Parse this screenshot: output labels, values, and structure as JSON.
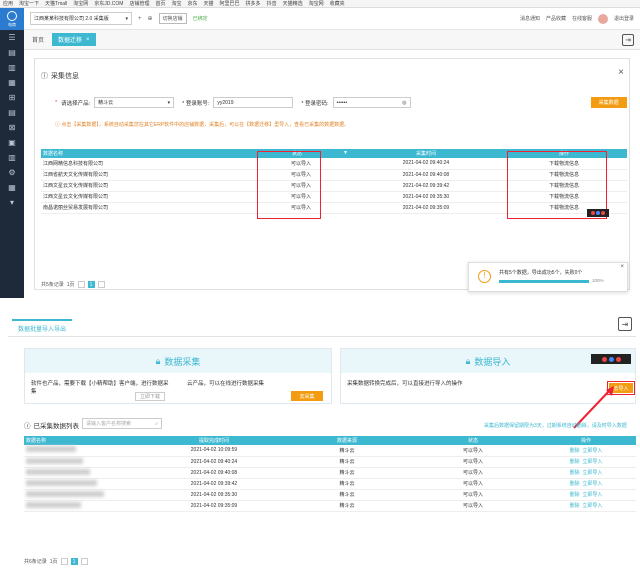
{
  "bookmarks": [
    "应用",
    "淘宝一下",
    "天猫Tmall",
    "淘宝网",
    "京东JD.COM",
    "店铺管理",
    "首页",
    "淘宝",
    "京东",
    "天猫",
    "阿里巴巴",
    "拼多多",
    "抖音",
    "天猫精选",
    "淘宝网",
    "收藏夹"
  ],
  "sidebar": {
    "logo_text": "电商",
    "icons": [
      "☰",
      "▤",
      "▥",
      "▦",
      "⊞",
      "▤",
      "⊠",
      "▣",
      "▥",
      "⚙",
      "▦",
      "▾"
    ]
  },
  "topbar": {
    "store_name": "江西某某科技有限公司 2.0 采集版",
    "refresh_btn": "切换店铺",
    "status": "已绑定",
    "right_items": [
      "消息通知",
      "产品收藏",
      "在线客服",
      "退出登录"
    ]
  },
  "tabs": {
    "home": "首页",
    "active": "数据迁移",
    "close": "×"
  },
  "modal1": {
    "title": "采集信息",
    "close": "×",
    "form": {
      "product_label": "请选择产品:",
      "product_value": "精斗云",
      "account_label": "* 登录账号:",
      "account_value": "yy2019",
      "password_label": "* 登录密码:",
      "password_value": "••••••",
      "submit": "采集数据"
    },
    "notice": "ⓘ 点击【采集数据】，系统自动采集您在其它ERP软件中的店铺数据，采集后，可以在【数据迁移】里导入，查看已采集的数据数据。",
    "table": {
      "headers": [
        "数据名称",
        "状态",
        "采集时间",
        "操作"
      ],
      "rows": [
        {
          "name": "江西网精信息科技有限公司",
          "status": "可以导入",
          "time": "2021-04-02 09:40:24",
          "op": "下载物流信息"
        },
        {
          "name": "江西省航天文化传媒有限公司",
          "status": "可以导入",
          "time": "2021-04-02 09:40:08",
          "op": "下载物流信息"
        },
        {
          "name": "江西文星云文化传媒有限公司",
          "status": "可以导入",
          "time": "2021-04-02 09:39:42",
          "op": "下载物流信息"
        },
        {
          "name": "江西文星云文化传媒有限公司",
          "status": "可以导入",
          "time": "2021-04-02 09:35:30",
          "op": "下载物流信息"
        },
        {
          "name": "南昌诺丽丝贸易发展有限公司",
          "status": "可以导入",
          "time": "2021-04-02 09:35:09",
          "op": "下载物流信息"
        }
      ]
    },
    "pager": {
      "total": "共5条记录",
      "page_count": "1页",
      "current": "1"
    }
  },
  "progress": {
    "message": "共有5个数据，导出成功5个，失败0个",
    "percent_value": 100,
    "percent_text": "100%",
    "close": "×"
  },
  "lower": {
    "tab_label": "数据批量导入导出",
    "card_collect": {
      "title": "数据采集",
      "desc": "软件也产品，需要下载【小精帮助】客户端，进行数据采集",
      "cloud_desc": "云产品，可以在线进行数据采集",
      "btn_download": "立即下载",
      "btn_collect": "去采集"
    },
    "card_import": {
      "title": "数据导入",
      "desc": "采集数据转换完成后，可以直接进行导入的操作",
      "btn_import": "去导入"
    },
    "list_title": "已采集数据列表",
    "search_placeholder": "请输入客户名称搜索",
    "hint": "采集后数据保留期限为3天，过期系统自动删除，请及时导入数据",
    "table": {
      "headers": [
        "数据名称",
        "提取完成时间",
        "数据来源",
        "状态",
        "操作"
      ],
      "rows": [
        {
          "time": "2021-04-02 10:09:59",
          "source": "精斗云",
          "status": "可以导入",
          "delete": "删除",
          "import": "立即导入"
        },
        {
          "time": "2021-04-02 09:40:24",
          "source": "精斗云",
          "status": "可以导入",
          "delete": "删除",
          "import": "立即导入"
        },
        {
          "time": "2021-04-02 09:40:08",
          "source": "精斗云",
          "status": "可以导入",
          "delete": "删除",
          "import": "立即导入"
        },
        {
          "time": "2021-04-02 09:39:42",
          "source": "精斗云",
          "status": "可以导入",
          "delete": "删除",
          "import": "立即导入"
        },
        {
          "time": "2021-04-02 09:35:30",
          "source": "精斗云",
          "status": "可以导入",
          "delete": "删除",
          "import": "立即导入"
        },
        {
          "time": "2021-04-02 09:35:09",
          "source": "精斗云",
          "status": "可以导入",
          "delete": "删除",
          "import": "立即导入"
        }
      ]
    },
    "pager": {
      "total": "共6条记录",
      "page_count": "1页",
      "current": "1"
    }
  },
  "colors": {
    "teal": "#3cb8d0",
    "orange": "#f39c12",
    "red_box": "#e22233",
    "sidebar": "#1e2a3a"
  }
}
